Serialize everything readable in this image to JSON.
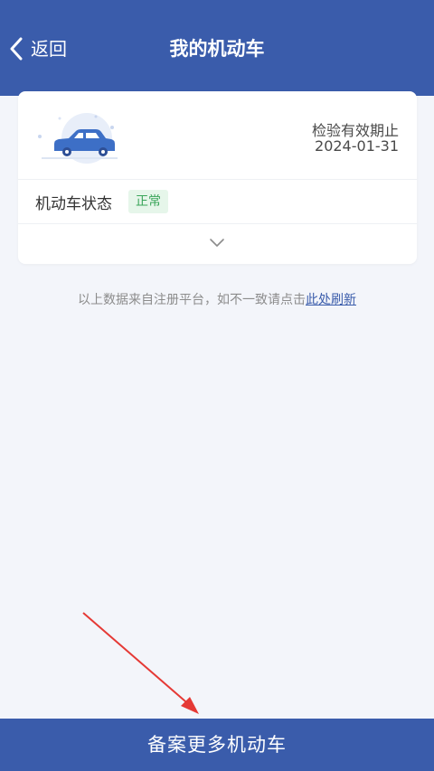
{
  "nav": {
    "back_label": "返回",
    "title": "我的机动车"
  },
  "vehicle_card": {
    "expiry_label": "检验有效期止",
    "expiry_date": "2024-01-31",
    "status_label": "机动车状态",
    "status_value": "正常"
  },
  "info": {
    "text": "以上数据来自注册平台，如不一致请点击",
    "link_text": "此处刷新"
  },
  "bottom": {
    "register_more_label": "备案更多机动车"
  },
  "colors": {
    "brand": "#3a5cab",
    "status_ok": "#3aa55a",
    "annotation_arrow": "#e53935"
  },
  "icons": {
    "back": "chevron-left-icon",
    "car": "car-icon",
    "expand": "chevron-down-icon"
  }
}
